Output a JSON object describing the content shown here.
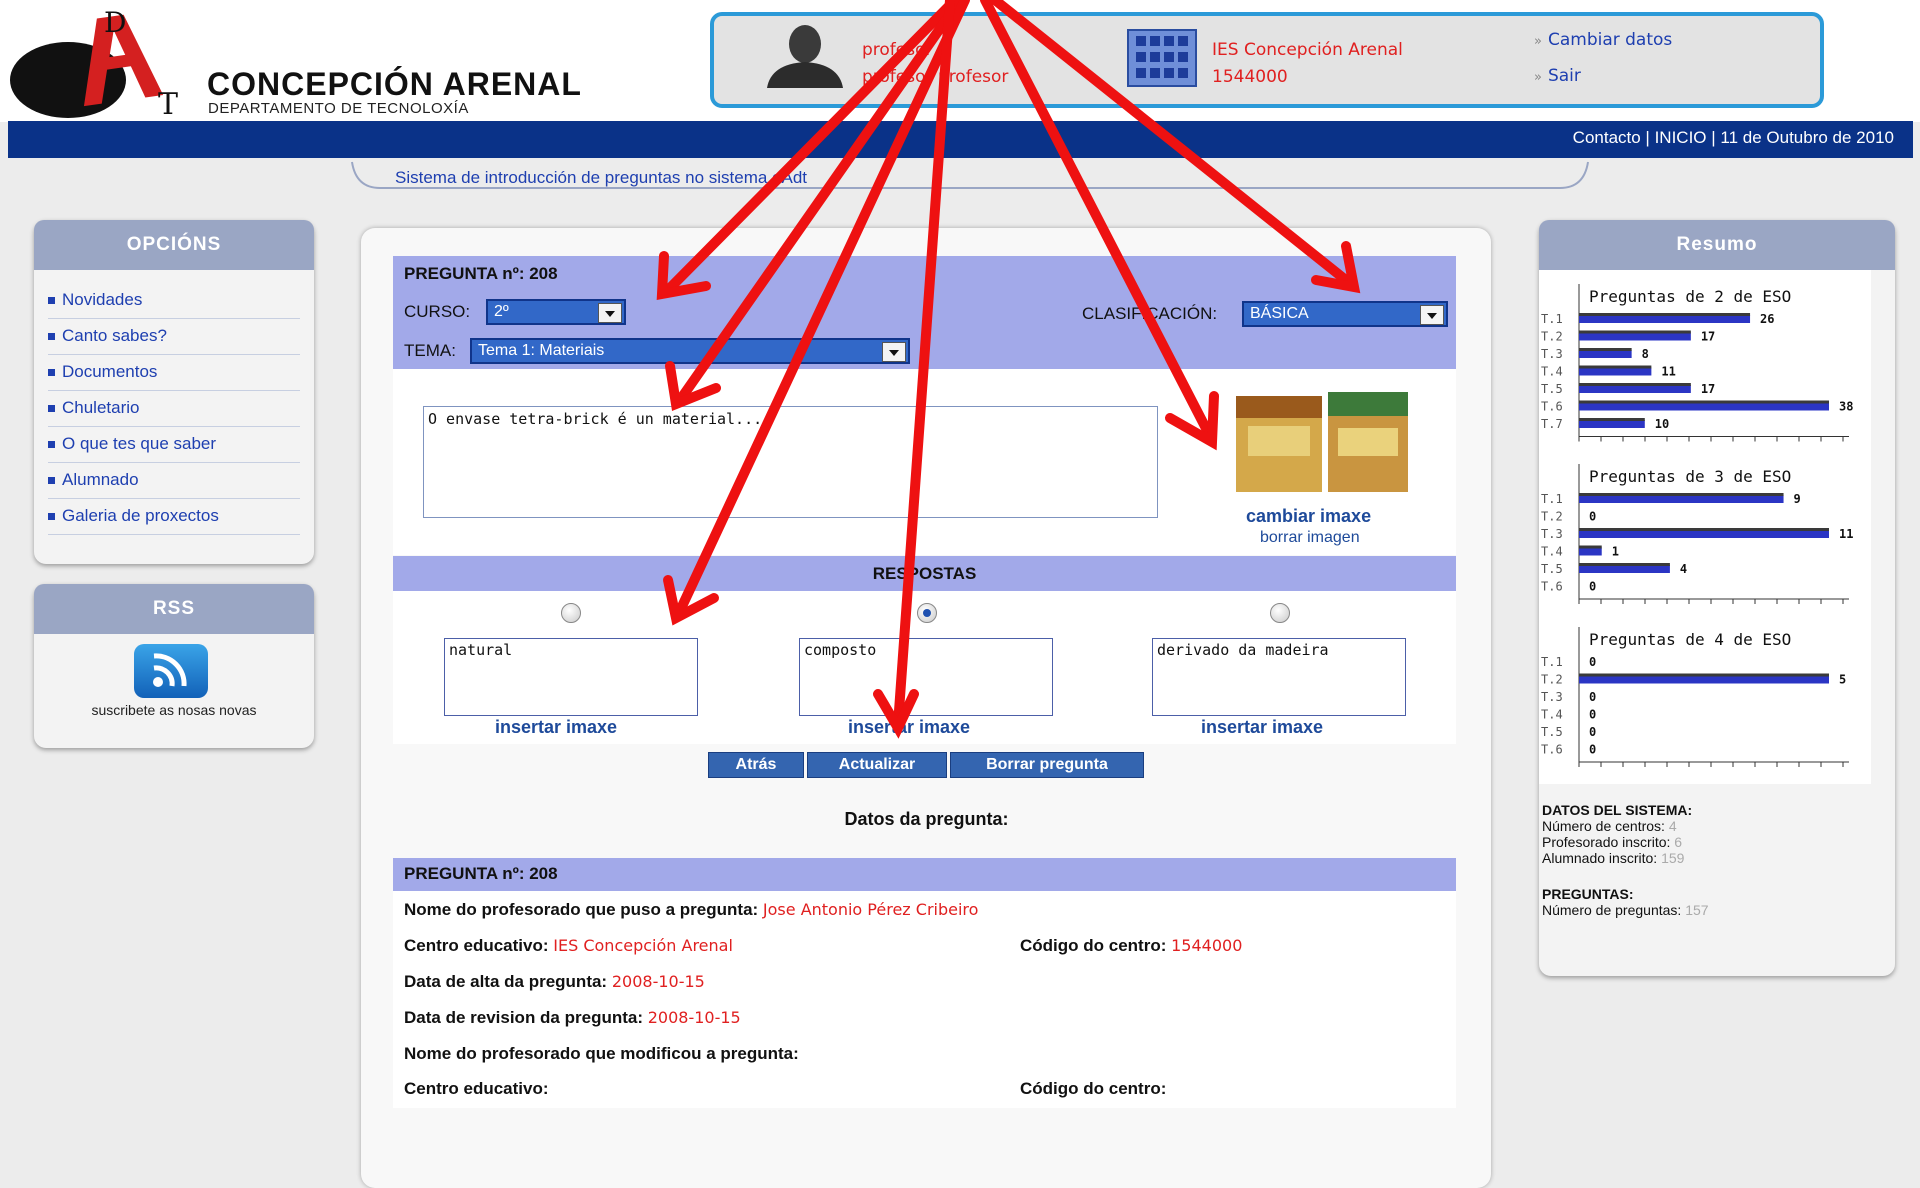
{
  "header": {
    "logo_letters": {
      "d": "D",
      "a": "A",
      "t": "T"
    },
    "brand_title": "CONCEPCIÓN  ARENAL",
    "brand_subtitle": "DEPARTAMENTO DE TECNOLOXÍA",
    "user_line1": "profesor",
    "user_line2": "profesor profesor",
    "center_name": "IES Concepción Arenal",
    "center_code": "1544000",
    "link_change": "Cambiar datos",
    "link_exit": "Sair",
    "link_chev": "»"
  },
  "navbar": {
    "text": "Contacto | INICIO | 11 de Outubro de 2010"
  },
  "breadcrumb": "Sistema de introducción de preguntas no sistema eAdt",
  "menu": {
    "title": "OPCIÓNS",
    "items": [
      "Novidades",
      "Canto sabes?",
      "Documentos",
      "Chuletario",
      "O que tes que saber",
      "Alumnado",
      "Galeria de proxectos"
    ]
  },
  "rss": {
    "title": "RSS",
    "text": "suscribete as nosas novas"
  },
  "question": {
    "title": "PREGUNTA nº: 208",
    "curso_label": "CURSO:",
    "curso_value": "2º",
    "clasificacion_label": "CLASIFICACIÓN:",
    "clasificacion_value": "BÁSICA",
    "tema_label": "TEMA:",
    "tema_value": "Tema 1: Materiais",
    "text": "O envase tetra-brick é un material...",
    "image_change": "cambiar imaxe",
    "image_delete": "borrar imagen"
  },
  "responses": {
    "title": "RESPOSTAS",
    "selected_index": 1,
    "answers": [
      "natural",
      "composto",
      "derivado da madeira"
    ],
    "insert_label": "insertar imaxe"
  },
  "buttons": {
    "back": "Atrás",
    "update": "Actualizar",
    "delete": "Borrar pregunta"
  },
  "info": {
    "title": "Datos da pregunta:",
    "head": "PREGUNTA nº: 208",
    "author_label": "Nome do profesorado que puso a pregunta:",
    "author_value": "Jose Antonio Pérez Cribeiro",
    "center_label": "Centro educativo:",
    "center_value": "IES Concepción Arenal",
    "code_label": "Código do centro:",
    "code_value": "1544000",
    "created_label": "Data de alta da pregunta:",
    "created_value": "2008-10-15",
    "revised_label": "Data de revision da pregunta:",
    "revised_value": "2008-10-15",
    "modifier_label": "Nome do profesorado que modificou a pregunta:",
    "center2_label": "Centro educativo:",
    "code2_label": "Código do centro:"
  },
  "resumo": {
    "title": "Resumo",
    "sys_title": "DATOS DEL SISTEMA:",
    "centros_label": "Número de centros:",
    "centros_value": "4",
    "prof_label": "Profesorado inscrito:",
    "prof_value": "6",
    "alum_label": "Alumnado inscrito:",
    "alum_value": "159",
    "preg_title": "PREGUNTAS:",
    "preg_label": "Número de preguntas:",
    "preg_value": "157"
  },
  "chart_data": [
    {
      "type": "bar",
      "title": "Preguntas de 2 de ESO",
      "categories": [
        "T.1",
        "T.2",
        "T.3",
        "T.4",
        "T.5",
        "T.6",
        "T.7"
      ],
      "values": [
        26,
        17,
        8,
        11,
        17,
        38,
        10
      ],
      "xlim": [
        0,
        38
      ]
    },
    {
      "type": "bar",
      "title": "Preguntas de 3 de ESO",
      "categories": [
        "T.1",
        "T.2",
        "T.3",
        "T.4",
        "T.5",
        "T.6"
      ],
      "values": [
        9,
        0,
        11,
        1,
        4,
        0
      ],
      "xlim": [
        0,
        11
      ]
    },
    {
      "type": "bar",
      "title": "Preguntas de 4 de ESO",
      "categories": [
        "T.1",
        "T.2",
        "T.3",
        "T.4",
        "T.5",
        "T.6"
      ],
      "values": [
        0,
        5,
        0,
        0,
        0,
        0
      ],
      "xlim": [
        0,
        5
      ]
    }
  ],
  "colors": {
    "navbar": "#0a3288",
    "band": "#a2a9e9",
    "accent_red": "#e02020",
    "link": "#1e3fb0",
    "bar_blue": "#2b35c4",
    "bar_green": "#22bb22",
    "bar_red": "#e82020"
  },
  "icons": {
    "user": "user-silhouette-icon",
    "center": "building-icon",
    "rss": "rss-feed-icon",
    "menu_bullet": "square-bullet-icon"
  }
}
